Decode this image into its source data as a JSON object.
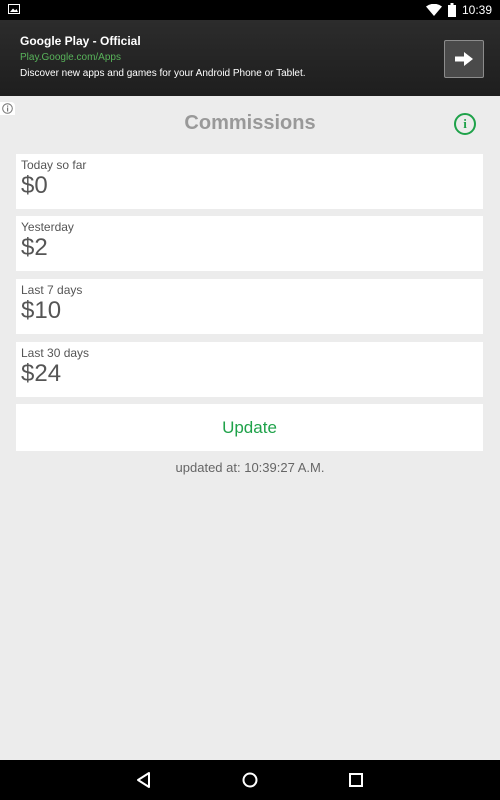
{
  "status_bar": {
    "time": "10:39"
  },
  "ad": {
    "title": "Google Play - Official",
    "url": "Play.Google.com/Apps",
    "description": "Discover new apps and games for your Android Phone or Tablet."
  },
  "header": {
    "title": "Commissions"
  },
  "cards": [
    {
      "label": "Today so far",
      "value": "$0"
    },
    {
      "label": "Yesterday",
      "value": "$2"
    },
    {
      "label": "Last 7 days",
      "value": "$10"
    },
    {
      "label": "Last 30 days",
      "value": "$24"
    }
  ],
  "update_button": {
    "label": "Update"
  },
  "updated_text": "updated at: 10:39:27 A.M.",
  "colors": {
    "accent": "#1fa24a",
    "ad_url": "#58b35a"
  },
  "icons": [
    "image-icon",
    "wifi-icon",
    "battery-icon",
    "arrow-right-icon",
    "ad-info-icon",
    "info-icon",
    "back-icon",
    "home-icon",
    "recents-icon"
  ]
}
